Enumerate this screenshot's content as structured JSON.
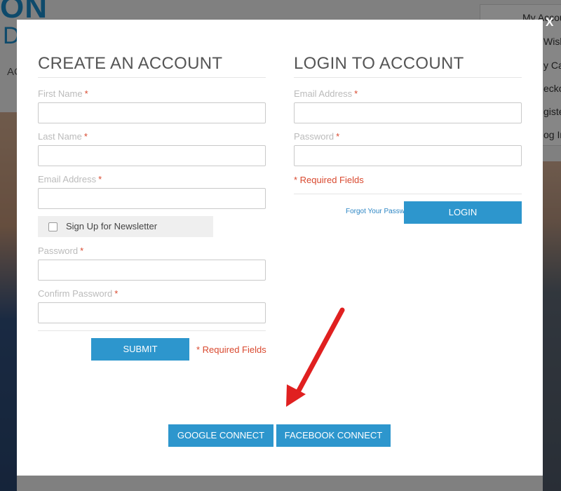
{
  "background": {
    "logo_top": "ON",
    "logo_bottom": "D",
    "nav_partial": "AC",
    "menu_items": [
      "My Accou",
      "Wish",
      "y Ca",
      "ecko",
      "giste",
      "og In"
    ]
  },
  "modal": {
    "close": "X",
    "create": {
      "title": "CREATE AN ACCOUNT",
      "first_name_label": "First Name",
      "last_name_label": "Last Name",
      "email_label": "Email Address",
      "newsletter_label": "Sign Up for Newsletter",
      "password_label": "Password",
      "confirm_password_label": "Confirm Password",
      "required_marker": "*",
      "submit_label": "SUBMIT",
      "required_fields": "* Required Fields"
    },
    "login": {
      "title": "LOGIN TO ACCOUNT",
      "email_label": "Email Address",
      "password_label": "Password",
      "required_marker": "*",
      "required_fields": "* Required Fields",
      "forgot_label": "Forgot Your Password?",
      "login_label": "LOGIN"
    },
    "social": {
      "google_label": "GOOGLE CONNECT",
      "facebook_label": "FACEBOOK CONNECT"
    }
  },
  "colors": {
    "accent": "#2d96cd",
    "required": "#d9492f",
    "arrow": "#e02020"
  }
}
